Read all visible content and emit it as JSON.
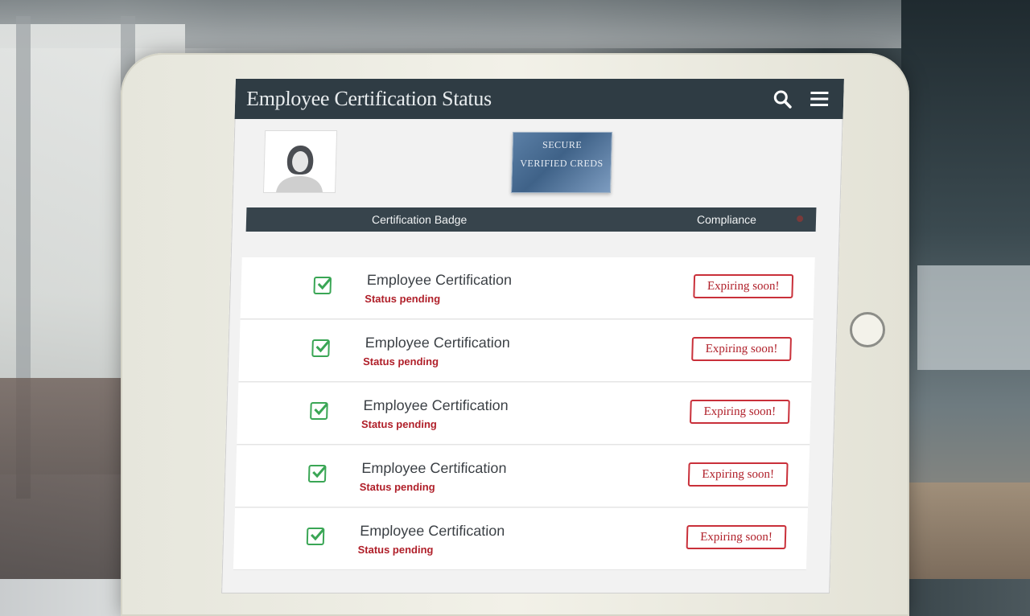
{
  "header": {
    "title": "Employee Certification Status",
    "search_icon": "search-icon",
    "menu_icon": "hamburger-menu-icon"
  },
  "profile": {
    "avatar_icon": "person-silhouette-icon",
    "card_line1": "SECURE",
    "card_line2": "VERIFIED CREDS"
  },
  "table": {
    "columns": [
      "Certification Badge",
      "Compliance"
    ]
  },
  "rows": [
    {
      "title": "Employee Certification",
      "subtitle": "Status pending",
      "status": "Expiring soon!"
    },
    {
      "title": "Employee Certification",
      "subtitle": "Status pending",
      "status": "Expiring soon!"
    },
    {
      "title": "Employee Certification",
      "subtitle": "Status pending",
      "status": "Expiring soon!"
    },
    {
      "title": "Employee Certification",
      "subtitle": "Status pending",
      "status": "Expiring soon!"
    },
    {
      "title": "Employee Certification",
      "subtitle": "Status pending",
      "status": "Expiring soon!"
    }
  ],
  "colors": {
    "header_bg": "#2f3c44",
    "check_green": "#3aa655",
    "alert_red": "#c9303a"
  }
}
